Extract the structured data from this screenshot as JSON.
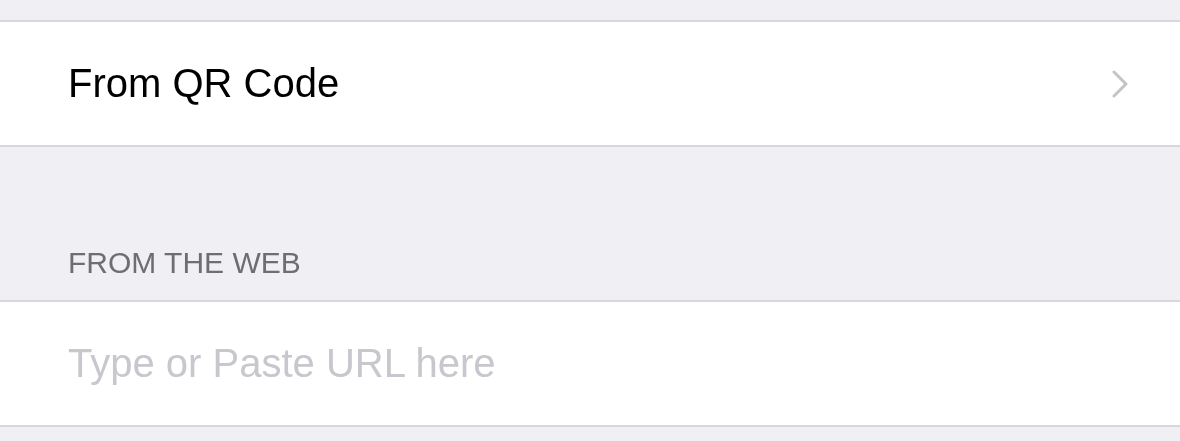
{
  "rows": [
    {
      "label": "From QR Code",
      "kind": "link"
    }
  ],
  "section": {
    "header": "FROM THE WEB"
  },
  "url_field": {
    "placeholder": "Type or Paste URL here"
  }
}
